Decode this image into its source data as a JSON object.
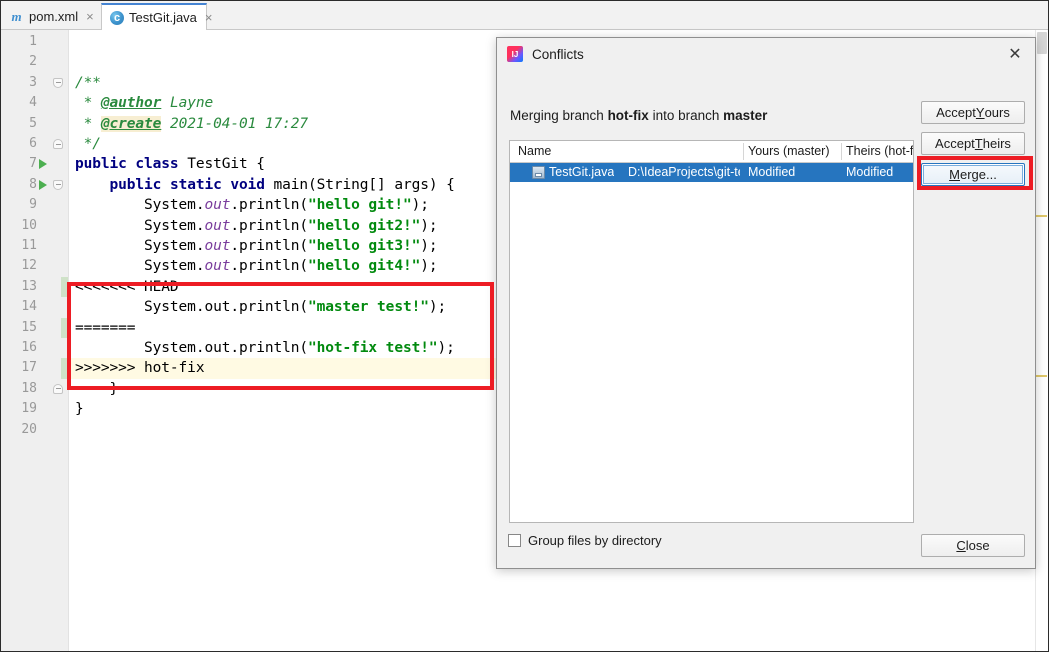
{
  "window": {
    "app": "IntelliJ IDEA",
    "app_icon": "intellij-idea-icon"
  },
  "tabs": [
    {
      "label": "pom.xml",
      "icon": "maven-file-icon",
      "icon_glyph": "m",
      "close": "×",
      "active": false
    },
    {
      "label": "TestGit.java",
      "icon": "java-file-icon",
      "icon_glyph": "c",
      "close": "×",
      "active": true
    }
  ],
  "editor": {
    "filename": "TestGit.java",
    "language": "java",
    "caret_line": 17,
    "lines": [
      {
        "n": "1",
        "segments": []
      },
      {
        "n": "2",
        "segments": []
      },
      {
        "n": "3",
        "fold": "top",
        "segments": [
          {
            "t": "/**",
            "c": "cmt"
          }
        ]
      },
      {
        "n": "4",
        "segments": [
          {
            "t": " * ",
            "c": "cmt"
          },
          {
            "t": "@author",
            "c": "tag"
          },
          {
            "t": " Layne",
            "c": "cmt"
          }
        ]
      },
      {
        "n": "5",
        "segments": [
          {
            "t": " * ",
            "c": "cmt"
          },
          {
            "t": "@create",
            "c": "tag-hl"
          },
          {
            "t": " 2021-04-01 17:27",
            "c": "cmt"
          }
        ]
      },
      {
        "n": "6",
        "fold": "bottom",
        "segments": [
          {
            "t": " */",
            "c": "cmt"
          }
        ]
      },
      {
        "n": "7",
        "run": true,
        "segments": [
          {
            "t": "public class ",
            "c": "kw"
          },
          {
            "t": "TestGit {",
            "c": "plain"
          }
        ]
      },
      {
        "n": "8",
        "run": true,
        "fold": "top",
        "segments": [
          {
            "t": "    ",
            "c": "plain"
          },
          {
            "t": "public static void ",
            "c": "kw"
          },
          {
            "t": "main(String[] args) {",
            "c": "plain"
          }
        ]
      },
      {
        "n": "9",
        "segments": [
          {
            "t": "        System.",
            "c": "plain"
          },
          {
            "t": "out",
            "c": "fld"
          },
          {
            "t": ".println(",
            "c": "plain"
          },
          {
            "t": "\"hello git!\"",
            "c": "str"
          },
          {
            "t": ");",
            "c": "plain"
          }
        ]
      },
      {
        "n": "10",
        "segments": [
          {
            "t": "        System.",
            "c": "plain"
          },
          {
            "t": "out",
            "c": "fld"
          },
          {
            "t": ".println(",
            "c": "plain"
          },
          {
            "t": "\"hello git2!\"",
            "c": "str"
          },
          {
            "t": ");",
            "c": "plain"
          }
        ]
      },
      {
        "n": "11",
        "segments": [
          {
            "t": "        System.",
            "c": "plain"
          },
          {
            "t": "out",
            "c": "fld"
          },
          {
            "t": ".println(",
            "c": "plain"
          },
          {
            "t": "\"hello git3!\"",
            "c": "str"
          },
          {
            "t": ");",
            "c": "plain"
          }
        ]
      },
      {
        "n": "12",
        "segments": [
          {
            "t": "        System.",
            "c": "plain"
          },
          {
            "t": "out",
            "c": "fld"
          },
          {
            "t": ".println(",
            "c": "plain"
          },
          {
            "t": "\"hello git4!\"",
            "c": "str"
          },
          {
            "t": ");",
            "c": "plain"
          }
        ]
      },
      {
        "n": "13",
        "change": true,
        "segments": [
          {
            "t": "<<<<<<< HEAD",
            "c": "plain"
          }
        ]
      },
      {
        "n": "14",
        "segments": [
          {
            "t": "        System.out.println(",
            "c": "plain"
          },
          {
            "t": "\"master test!\"",
            "c": "str"
          },
          {
            "t": ");",
            "c": "plain"
          }
        ]
      },
      {
        "n": "15",
        "change": true,
        "segments": [
          {
            "t": "=======",
            "c": "plain"
          }
        ]
      },
      {
        "n": "16",
        "segments": [
          {
            "t": "        System.out.println(",
            "c": "plain"
          },
          {
            "t": "\"hot-fix test!\"",
            "c": "str"
          },
          {
            "t": ");",
            "c": "plain"
          }
        ]
      },
      {
        "n": "17",
        "change": true,
        "highlight": true,
        "segments": [
          {
            "t": ">>>>>>> hot-fix",
            "c": "plain"
          }
        ]
      },
      {
        "n": "18",
        "fold": "bottom",
        "segments": [
          {
            "t": "    }",
            "c": "plain"
          }
        ]
      },
      {
        "n": "19",
        "segments": [
          {
            "t": "}",
            "c": "plain"
          }
        ]
      },
      {
        "n": "20",
        "segments": []
      }
    ]
  },
  "dialog": {
    "title": "Conflicts",
    "close_icon": "close-icon",
    "subtitle_prefix": "Merging branch ",
    "subtitle_branch_source": "hot-fix",
    "subtitle_middle": " into branch ",
    "subtitle_branch_target": "master",
    "table": {
      "columns": [
        "Name",
        "Yours (master)",
        "Theirs (hot-fix)"
      ],
      "rows": [
        {
          "name": "TestGit.java",
          "path": "D:\\IdeaProjects\\git-te",
          "yours": "Modified",
          "theirs": "Modified",
          "selected": true
        }
      ]
    },
    "buttons": {
      "accept_yours": {
        "pre": "Accept ",
        "mn": "Y",
        "post": "ours"
      },
      "accept_theirs": {
        "pre": "Accept ",
        "mn": "T",
        "post": "heirs"
      },
      "merge": {
        "pre": "",
        "mn": "M",
        "post": "erge...",
        "focused": true
      },
      "close": {
        "pre": "",
        "mn": "C",
        "post": "lose"
      }
    },
    "checkbox": {
      "label": "Group files by directory",
      "checked": false
    }
  },
  "annotations": [
    {
      "name": "conflict-markers-highlight"
    },
    {
      "name": "merge-button-highlight"
    }
  ],
  "colors": {
    "annotation_red": "#ed1c24",
    "selection_blue": "#2675bf",
    "keyword_navy": "#000080",
    "string_green": "#028a0f",
    "comment_green": "#2a8a3e",
    "caret_line": "#fffae3",
    "change_bar_green": "#cfe2c8"
  }
}
